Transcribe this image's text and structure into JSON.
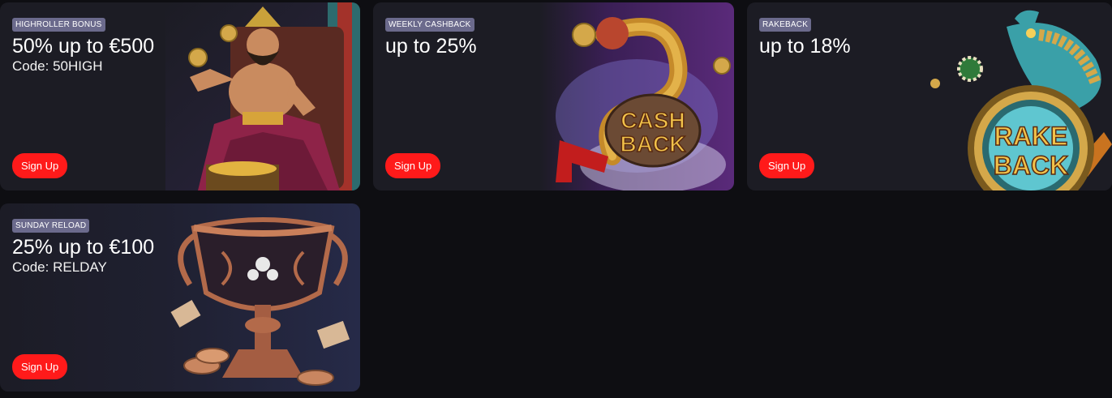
{
  "cards": [
    {
      "badge": "HIGHROLLER BONUS",
      "headline": "50% up to €500",
      "code": "Code: 50HIGH",
      "button": "Sign Up"
    },
    {
      "badge": "WEEKLY CASHBACK",
      "headline": "up to 25%",
      "button": "Sign Up",
      "art_text": [
        "CASH",
        "BACK"
      ]
    },
    {
      "badge": "RAKEBACK",
      "headline": "up to 18%",
      "button": "Sign Up",
      "art_text": [
        "RAKE",
        "BACK"
      ]
    },
    {
      "badge": "SUNDAY RELOAD",
      "headline": "25% up to €100",
      "code": "Code: RELDAY",
      "button": "Sign Up"
    }
  ],
  "colors": {
    "page_bg": "#0e0e12",
    "card_bg": "#1c1c24",
    "badge_bg": "#6b6a8c",
    "button_bg": "#ff1a1a"
  }
}
